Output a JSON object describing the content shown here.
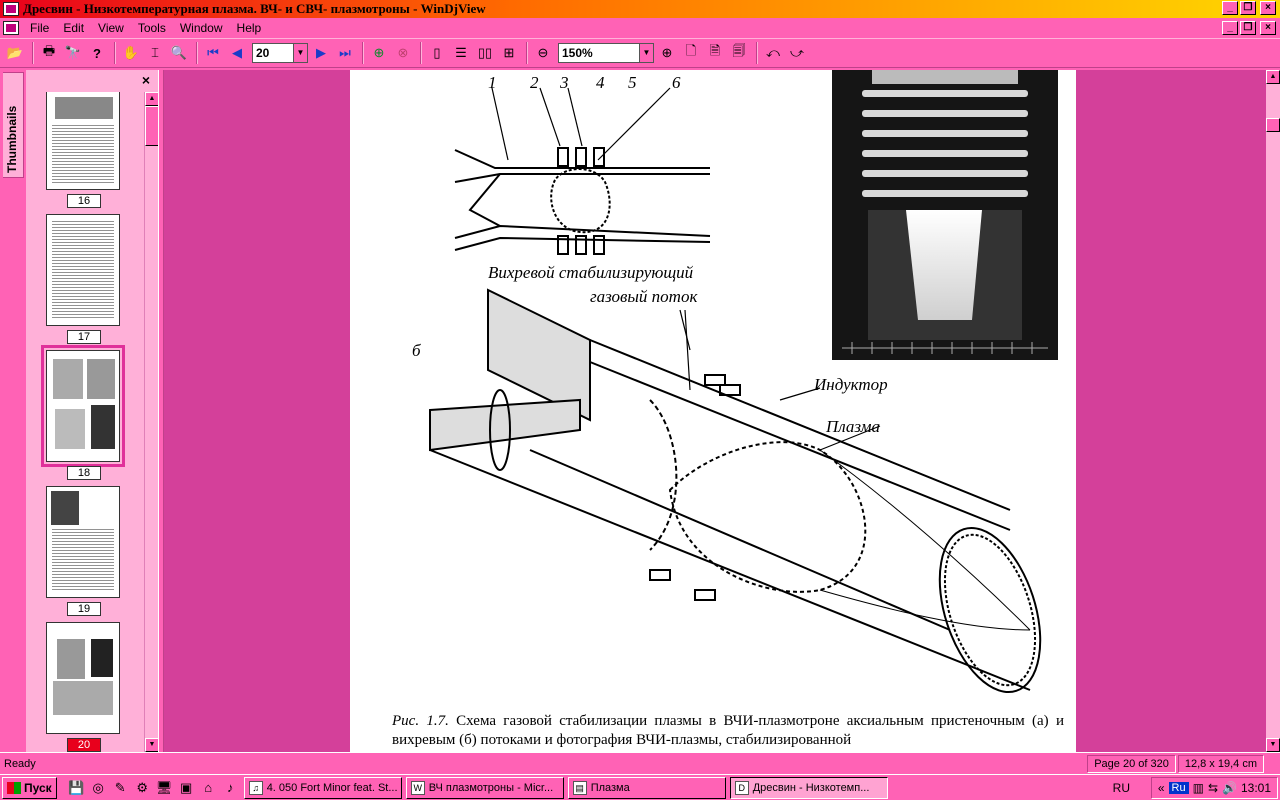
{
  "window": {
    "title": "Дресвин - Низкотемпературная плазма. ВЧ- и СВЧ- плазмотроны - WinDjView"
  },
  "menu": [
    "File",
    "Edit",
    "View",
    "Tools",
    "Window",
    "Help"
  ],
  "toolbar": {
    "page_value": "20",
    "zoom_value": "150%"
  },
  "thumbnails": {
    "tab_label": "Thumbnails",
    "close": "×",
    "pages": [
      "16",
      "17",
      "18",
      "19",
      "20"
    ],
    "current": "20"
  },
  "document": {
    "figure_labels": {
      "n1": "1",
      "n2": "2",
      "n3": "3",
      "n4": "4",
      "n5": "5",
      "n6": "6",
      "vortex_line1": "Вихревой стабилизирующий",
      "vortex_line2": "газовый поток",
      "b": "б",
      "inductor": "Индуктор",
      "plasma": "Плазма"
    },
    "caption_prefix": "Рис. 1.7.",
    "caption_text": " Схема газовой стабилизации плазмы в ВЧИ-плазмотроне аксиальным пристеночным (а) и вихревым (б) потоками и фотография ВЧИ-плазмы, стабилизированной"
  },
  "status": {
    "ready": "Ready",
    "page_info": "Page 20 of 320",
    "page_size": "12,8 x 19,4 cm"
  },
  "taskbar": {
    "start": "Пуск",
    "tasks": [
      {
        "label": "4. 050 Fort Minor feat. St...",
        "active": false
      },
      {
        "label": "ВЧ плазмотроны - Micr...",
        "active": false
      },
      {
        "label": "Плазма",
        "active": false
      },
      {
        "label": "Дресвин - Низкотемп...",
        "active": true
      }
    ],
    "lang": "RU",
    "lang_box": "Ru",
    "clock": "13:01",
    "chevrons": "«"
  },
  "colors": {
    "chrome": "#ff62b5",
    "panel": "#ffb0d8",
    "doc_bg": "#d4409a",
    "current_page_badge": "#e8001c"
  }
}
